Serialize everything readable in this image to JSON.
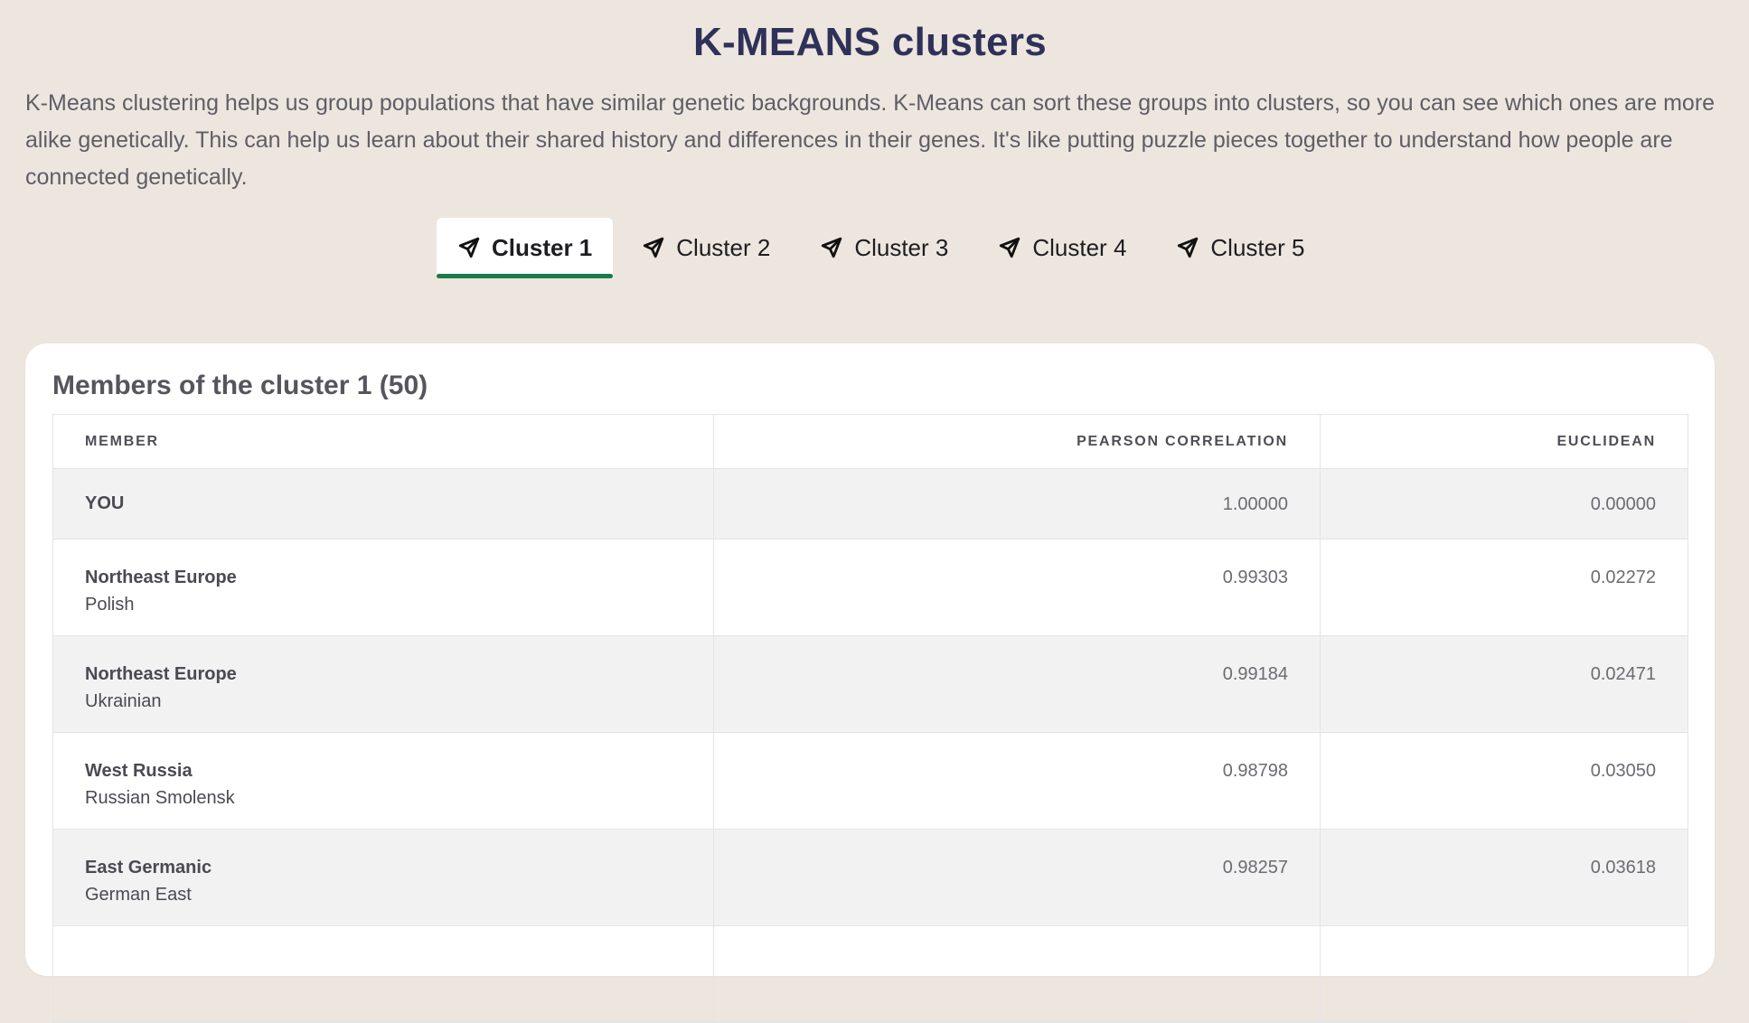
{
  "page": {
    "title": "K-MEANS clusters",
    "intro": "K-Means clustering helps us group populations that have similar genetic backgrounds. K-Means can sort these groups into clusters, so you can see which ones are more alike genetically. This can help us learn about their shared history and differences in their genes. It's like putting puzzle pieces together to understand how people are connected genetically."
  },
  "tabs": [
    {
      "label": "Cluster 1",
      "icon": "send-icon",
      "active": true
    },
    {
      "label": "Cluster 2",
      "icon": "send-icon",
      "active": false
    },
    {
      "label": "Cluster 3",
      "icon": "send-icon",
      "active": false
    },
    {
      "label": "Cluster 4",
      "icon": "send-icon",
      "active": false
    },
    {
      "label": "Cluster 5",
      "icon": "send-icon",
      "active": false
    }
  ],
  "colors": {
    "background": "#ede6df",
    "title": "#2f3158",
    "active_tab_underline": "#1d7a4c",
    "card": "#ffffff",
    "striped_row": "#f2f2f2"
  },
  "members": {
    "title": "Members of the cluster 1 (50)",
    "columns": {
      "member": "MEMBER",
      "pearson": "PEARSON CORRELATION",
      "euclidean": "EUCLIDEAN"
    },
    "you": {
      "label": "YOU",
      "pearson": "1.00000",
      "euclidean": "0.00000"
    },
    "rows": [
      {
        "region": "Northeast Europe",
        "population": "Polish",
        "pearson": "0.99303",
        "euclidean": "0.02272"
      },
      {
        "region": "Northeast Europe",
        "population": "Ukrainian",
        "pearson": "0.99184",
        "euclidean": "0.02471"
      },
      {
        "region": "West Russia",
        "population": "Russian Smolensk",
        "pearson": "0.98798",
        "euclidean": "0.03050"
      },
      {
        "region": "East Germanic",
        "population": "German East",
        "pearson": "0.98257",
        "euclidean": "0.03618"
      }
    ]
  }
}
